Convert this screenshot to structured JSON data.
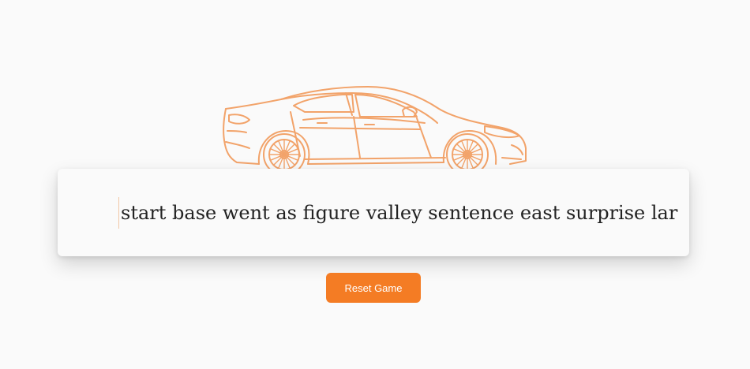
{
  "game": {
    "words_text": "start base went as figure valley sentence east surprise lar"
  },
  "controls": {
    "reset_label": "Reset Game"
  },
  "colors": {
    "accent": "#f47c24",
    "car_stroke": "#f2a36a",
    "background": "#fafafa",
    "text": "#222222"
  },
  "icons": {
    "car": "sports-car-outline-icon"
  }
}
